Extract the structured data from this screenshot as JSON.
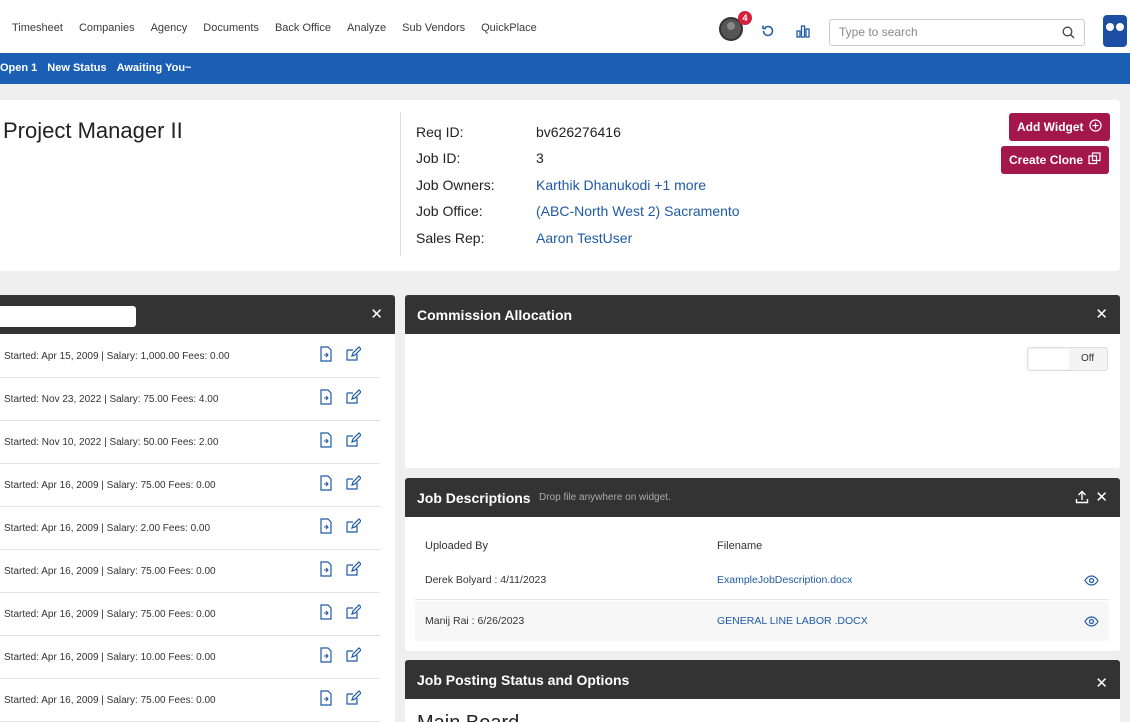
{
  "nav": {
    "links": [
      "Timesheet",
      "Companies",
      "Agency",
      "Documents",
      "Back Office",
      "Analyze",
      "Sub Vendors",
      "QuickPlace"
    ],
    "notification_count": "4",
    "search_placeholder": "Type to search"
  },
  "status_bar": {
    "items": [
      "Open 1",
      "New Status",
      "Awaiting You~"
    ]
  },
  "job": {
    "title": "Project Manager II",
    "fields": [
      {
        "label": "Req ID:",
        "value": "bv626276416",
        "link": false
      },
      {
        "label": "Job ID:",
        "value": "3",
        "link": false
      },
      {
        "label": "Job Owners:",
        "value": "Karthik Dhanukodi +1 more",
        "link": true
      },
      {
        "label": "Job Office:",
        "value": "(ABC-North West 2) Sacramento",
        "link": true
      },
      {
        "label": "Sales Rep:",
        "value": "Aaron TestUser",
        "link": true
      }
    ],
    "add_widget_label": "Add Widget",
    "create_clone_label": "Create Clone"
  },
  "left_widget": {
    "rows": [
      "Started: Apr 15, 2009 | Salary: 1,000.00 Fees: 0.00",
      "Started: Nov 23, 2022 | Salary: 75.00 Fees: 4.00",
      "Started: Nov 10, 2022 | Salary: 50.00 Fees: 2.00",
      "Started: Apr 16, 2009 | Salary: 75.00 Fees: 0.00",
      "Started: Apr 16, 2009 | Salary: 2.00 Fees: 0.00",
      "Started: Apr 16, 2009 | Salary: 75.00 Fees: 0.00",
      "Started: Apr 16, 2009 | Salary: 75.00 Fees: 0.00",
      "Started: Apr 16, 2009 | Salary: 10.00 Fees: 0.00",
      "Started: Apr 16, 2009 | Salary: 75.00 Fees: 0.00"
    ]
  },
  "commission": {
    "title": "Commission Allocation",
    "toggle_label": "Off"
  },
  "job_descriptions": {
    "title": "Job Descriptions",
    "subtitle": "Drop file anywhere on widget.",
    "col_uploaded_by": "Uploaded By",
    "col_filename": "Filename",
    "rows": [
      {
        "uploaded_by": "Derek Bolyard : 4/11/2023",
        "filename": "ExampleJobDescription.docx"
      },
      {
        "uploaded_by": "Manij Rai : 6/26/2023",
        "filename": "GENERAL LINE LABOR .DOCX"
      }
    ]
  },
  "job_posting": {
    "title": "Job Posting Status and Options",
    "section": "Main Board"
  }
}
